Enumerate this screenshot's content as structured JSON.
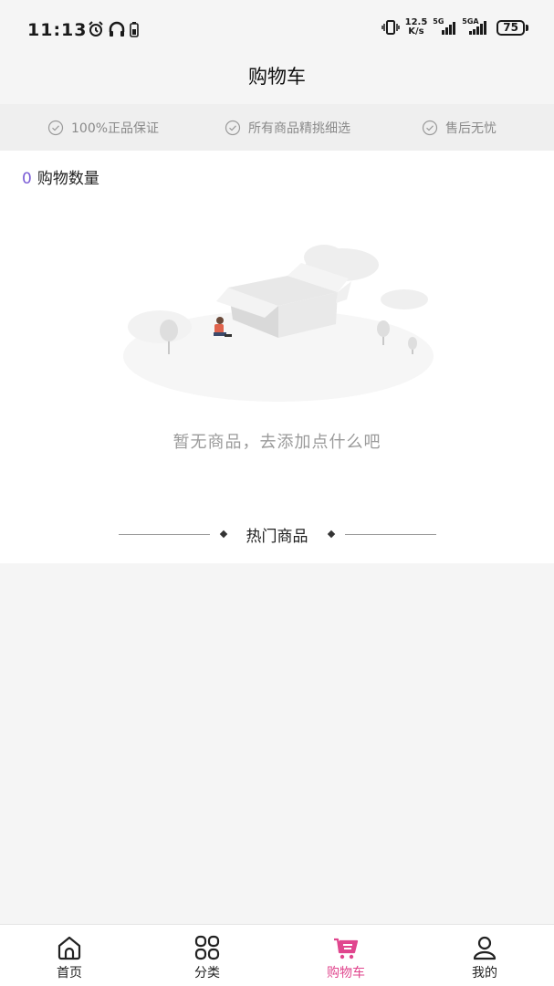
{
  "status_bar": {
    "time": "11:13",
    "speed_value": "12.5",
    "speed_unit": "K/s",
    "sim1_label": "5G",
    "sim2_label": "5GA",
    "battery": "75"
  },
  "header": {
    "title": "购物车"
  },
  "guarantees": [
    {
      "label": "100%正品保证"
    },
    {
      "label": "所有商品精挑细选"
    },
    {
      "label": "售后无忧"
    }
  ],
  "cart": {
    "count": "0",
    "count_label": "购物数量",
    "empty_message": "暂无商品，去添加点什么吧"
  },
  "hot": {
    "title": "热门商品"
  },
  "bottom_nav": [
    {
      "label": "首页",
      "icon": "home-icon"
    },
    {
      "label": "分类",
      "icon": "grid-icon"
    },
    {
      "label": "购物车",
      "icon": "cart-icon",
      "active": true
    },
    {
      "label": "我的",
      "icon": "user-icon"
    }
  ],
  "colors": {
    "accent": "#e0468e",
    "count_color": "#7a5cd6"
  }
}
